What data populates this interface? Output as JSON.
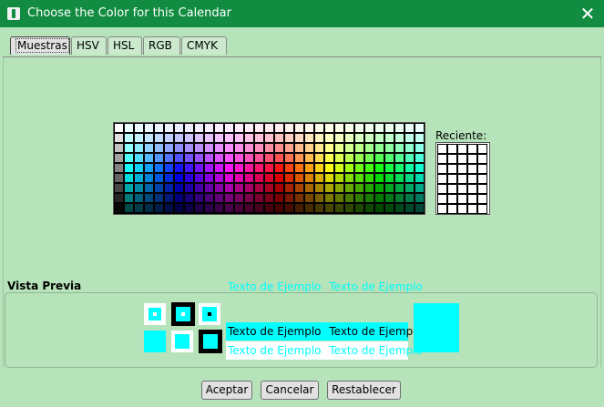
{
  "window": {
    "title": "Choose the Color for this Calendar",
    "close_glyph": "✕"
  },
  "tabs": [
    {
      "label": "Muestras",
      "active": true
    },
    {
      "label": "HSV"
    },
    {
      "label": "HSL"
    },
    {
      "label": "RGB"
    },
    {
      "label": "CMYK"
    }
  ],
  "recent": {
    "label": "Reciente:"
  },
  "preview": {
    "label": "Vista Previa",
    "sample_text": "Texto de Ejemplo",
    "color": "#00ffff"
  },
  "buttons": {
    "accept": "Aceptar",
    "cancel": "Cancelar",
    "reset": "Restablecer"
  },
  "colors": {
    "titlebar": "#118c41",
    "background": "#b6e3b9",
    "selected": "#00ffff"
  }
}
